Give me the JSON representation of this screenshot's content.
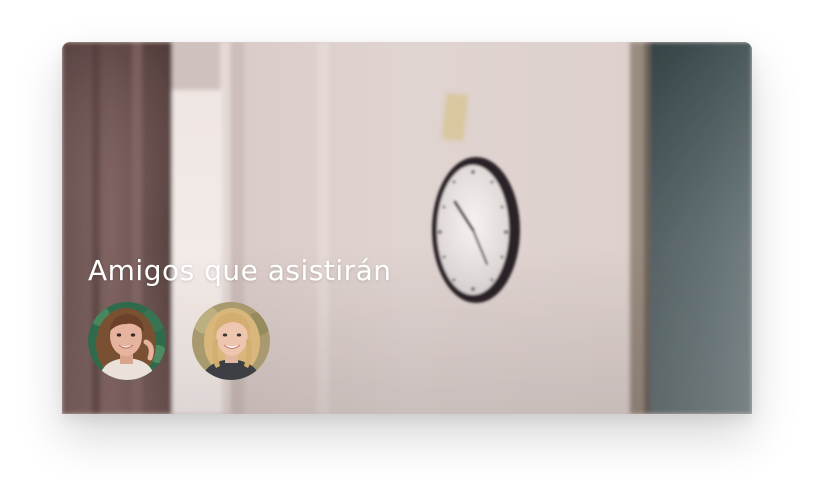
{
  "card": {
    "title": "Amigos que asistirán",
    "friends": [
      {
        "icon": "friend-avatar-photo-1"
      },
      {
        "icon": "friend-avatar-photo-2"
      }
    ]
  }
}
